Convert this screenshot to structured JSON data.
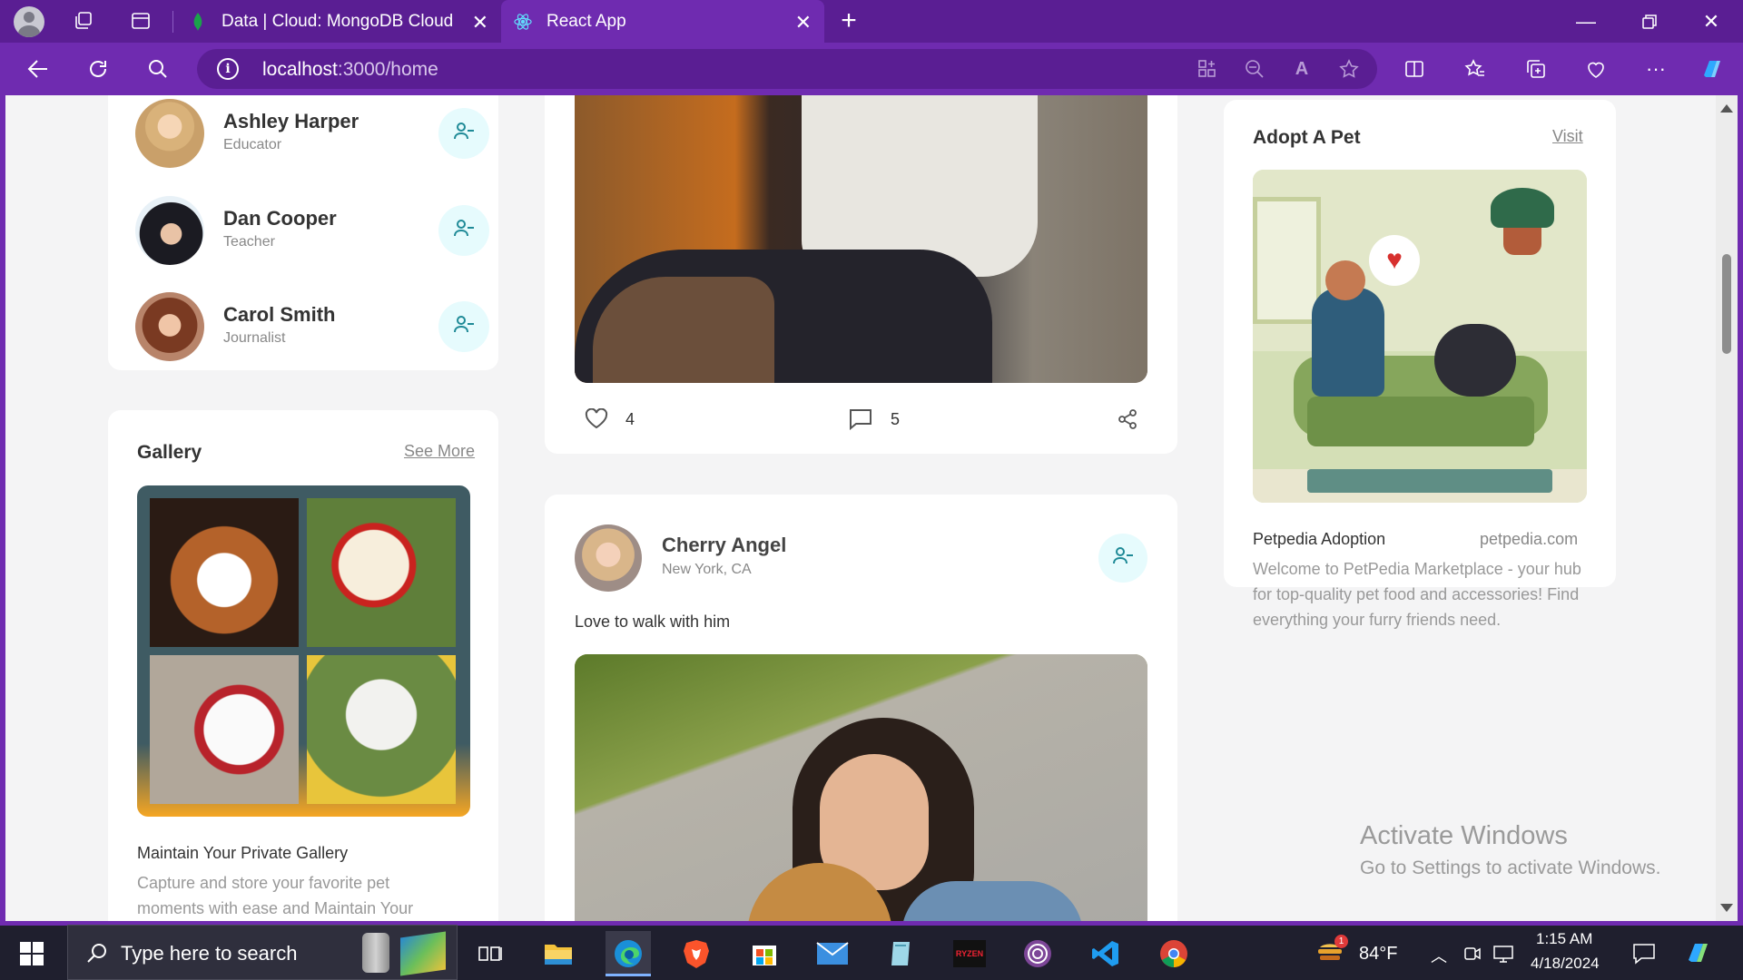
{
  "browser": {
    "tabs": [
      {
        "label": "Data | Cloud: MongoDB Cloud"
      },
      {
        "label": "React App"
      }
    ],
    "url_host": "localhost",
    "url_path": ":3000/home"
  },
  "friends": [
    {
      "name": "Ashley Harper",
      "occupation": "Educator"
    },
    {
      "name": "Dan Cooper",
      "occupation": "Teacher"
    },
    {
      "name": "Carol Smith",
      "occupation": "Journalist"
    }
  ],
  "gallery": {
    "title": "Gallery",
    "link": "See More",
    "subtitle": "Maintain Your Private Gallery",
    "description": "Capture and store your favorite pet moments with ease and Maintain Your"
  },
  "post1": {
    "likes": "4",
    "comments": "5"
  },
  "post2": {
    "author": "Cherry Angel",
    "location": "New York, CA",
    "caption": "Love to walk with him"
  },
  "ad": {
    "title": "Adopt A Pet",
    "link": "Visit",
    "name": "Petpedia Adoption",
    "site": "petpedia.com",
    "description": "Welcome to PetPedia Marketplace - your hub for top-quality pet food and accessories! Find everything your furry friends need."
  },
  "watermark": {
    "title": "Activate Windows",
    "sub": "Go to Settings to activate Windows."
  },
  "taskbar": {
    "search_placeholder": "Type here to search",
    "weather": "84°F",
    "weather_badge": "1",
    "time": "1:15 AM",
    "date": "4/18/2024"
  },
  "colors": {
    "browser_accent": "#6f2bb0",
    "add_button_bg": "#e6fbfd",
    "add_button_icon": "#1f8a97"
  }
}
